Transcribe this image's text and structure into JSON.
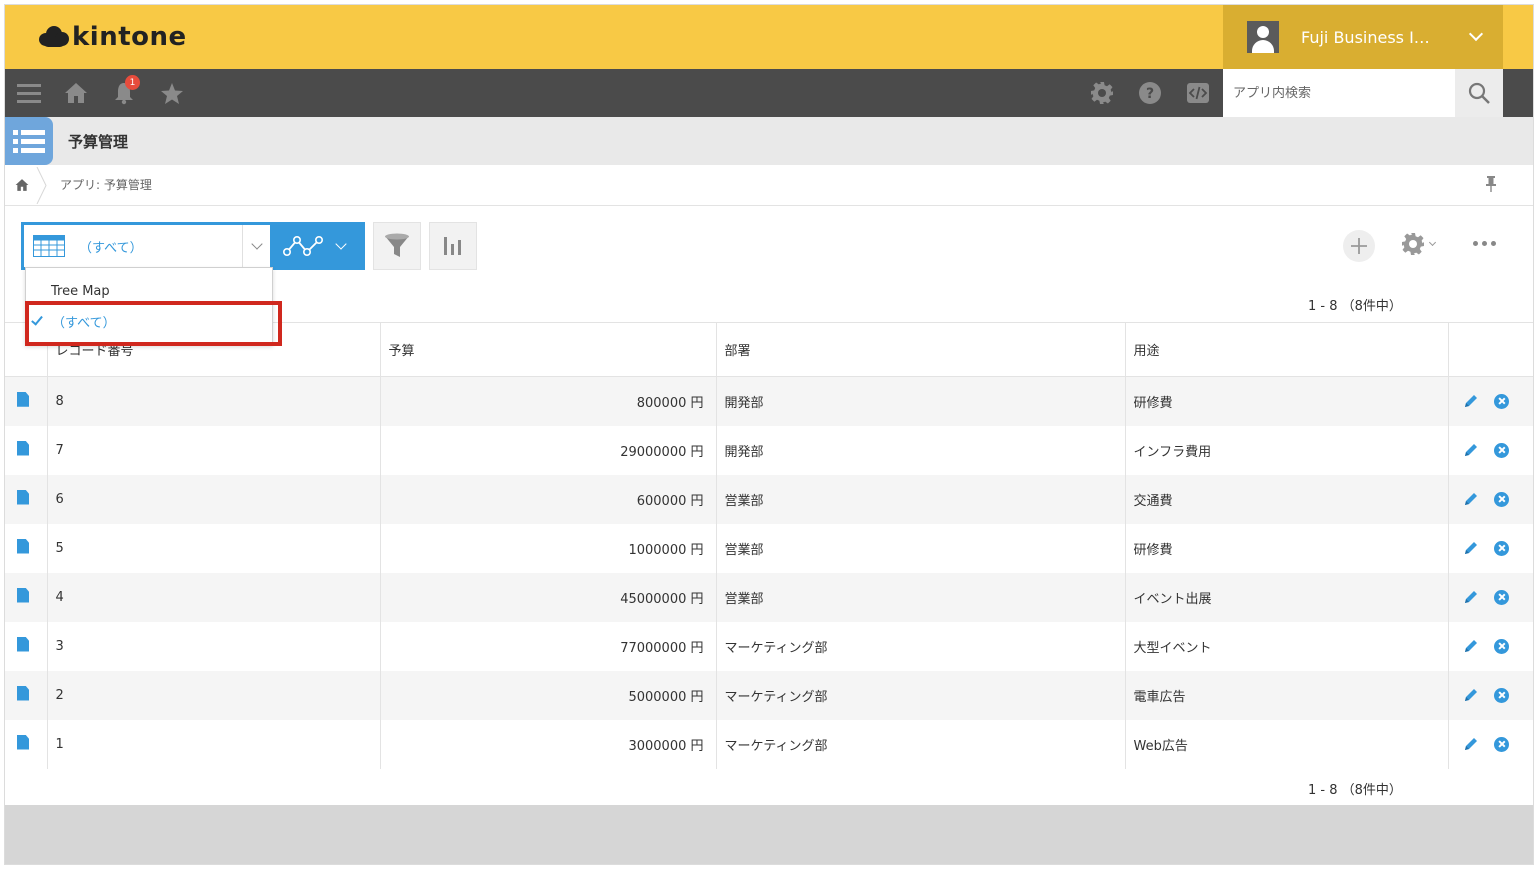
{
  "header": {
    "logo_text": "kintone",
    "user_name": "Fuji Business I…"
  },
  "nav": {
    "notification_count": "1",
    "search_placeholder": "アプリ内検索"
  },
  "app": {
    "title": "予算管理"
  },
  "breadcrumb": {
    "path": "アプリ: 予算管理"
  },
  "view": {
    "selected_label": "（すべて）",
    "options": [
      "Tree Map",
      "（すべて）"
    ]
  },
  "pager": {
    "top": "1 - 8 （8件中）",
    "bottom": "1 - 8 （8件中）"
  },
  "table": {
    "columns": [
      "レコード番号",
      "予算",
      "部署",
      "用途"
    ],
    "rows": [
      {
        "id": "8",
        "budget": "800000 円",
        "dept": "開発部",
        "purpose": "研修費"
      },
      {
        "id": "7",
        "budget": "29000000 円",
        "dept": "開発部",
        "purpose": "インフラ費用"
      },
      {
        "id": "6",
        "budget": "600000 円",
        "dept": "営業部",
        "purpose": "交通費"
      },
      {
        "id": "5",
        "budget": "1000000 円",
        "dept": "営業部",
        "purpose": "研修費"
      },
      {
        "id": "4",
        "budget": "45000000 円",
        "dept": "営業部",
        "purpose": "イベント出展"
      },
      {
        "id": "3",
        "budget": "77000000 円",
        "dept": "マーケティング部",
        "purpose": "大型イベント"
      },
      {
        "id": "2",
        "budget": "5000000 円",
        "dept": "マーケティング部",
        "purpose": "電車広告"
      },
      {
        "id": "1",
        "budget": "3000000 円",
        "dept": "マーケティング部",
        "purpose": "Web広告"
      }
    ]
  },
  "colors": {
    "header_yellow": "#f8c945",
    "user_box": "#d9ae31",
    "nav_dark": "#4b4b4b",
    "accent_blue": "#3498db",
    "highlight_red": "#d0281e"
  },
  "icons": {
    "nav": [
      "menu-icon",
      "home-icon",
      "bell-icon",
      "star-icon",
      "gear-icon",
      "help-icon",
      "code-icon",
      "search-icon"
    ],
    "toolbar": [
      "table-view-icon",
      "graph-icon",
      "filter-icon",
      "bar-chart-icon",
      "plus-icon",
      "gear-icon",
      "more-icon"
    ],
    "row": [
      "record-detail-icon",
      "edit-pencil-icon",
      "delete-icon"
    ]
  }
}
